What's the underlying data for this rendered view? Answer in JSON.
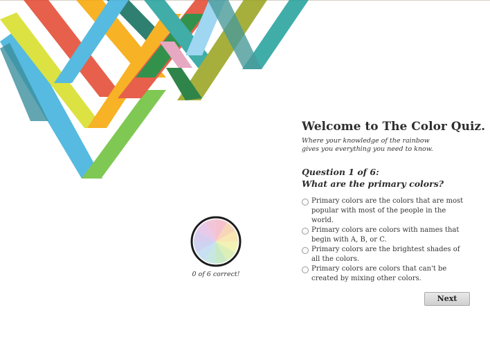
{
  "colors": {
    "blue": "#3aaedb",
    "yellow": "#d7de20",
    "orange": "#f6a500",
    "red": "#e2452c",
    "green": "#6bbf37",
    "teal": "#1f9f9b",
    "olive": "#97a21b",
    "pink": "#e39ab8",
    "button_bg": "#d9d9d9"
  },
  "header": {
    "title": "Welcome to The Color Quiz.",
    "subtitle_line1": "Where your knowledge of the rainbow",
    "subtitle_line2": "gives you everything you need to know."
  },
  "question": {
    "number": "Question 1 of 6:",
    "text": "What are the primary colors?"
  },
  "options": [
    {
      "label": "Primary colors are the colors that are most popular with most of the people in the world.",
      "selected": false
    },
    {
      "label": "Primary colors are colors with names that begin with A, B, or C.",
      "selected": false
    },
    {
      "label": "Primary colors are the brightest shades of all the colors.",
      "selected": false
    },
    {
      "label": "Primary colors are colors that can't be created by mixing other colors.",
      "selected": false
    }
  ],
  "buttons": {
    "next": "Next"
  },
  "progress": {
    "score_text": "0 of 6 correct!",
    "correct": 0,
    "total": 6
  }
}
